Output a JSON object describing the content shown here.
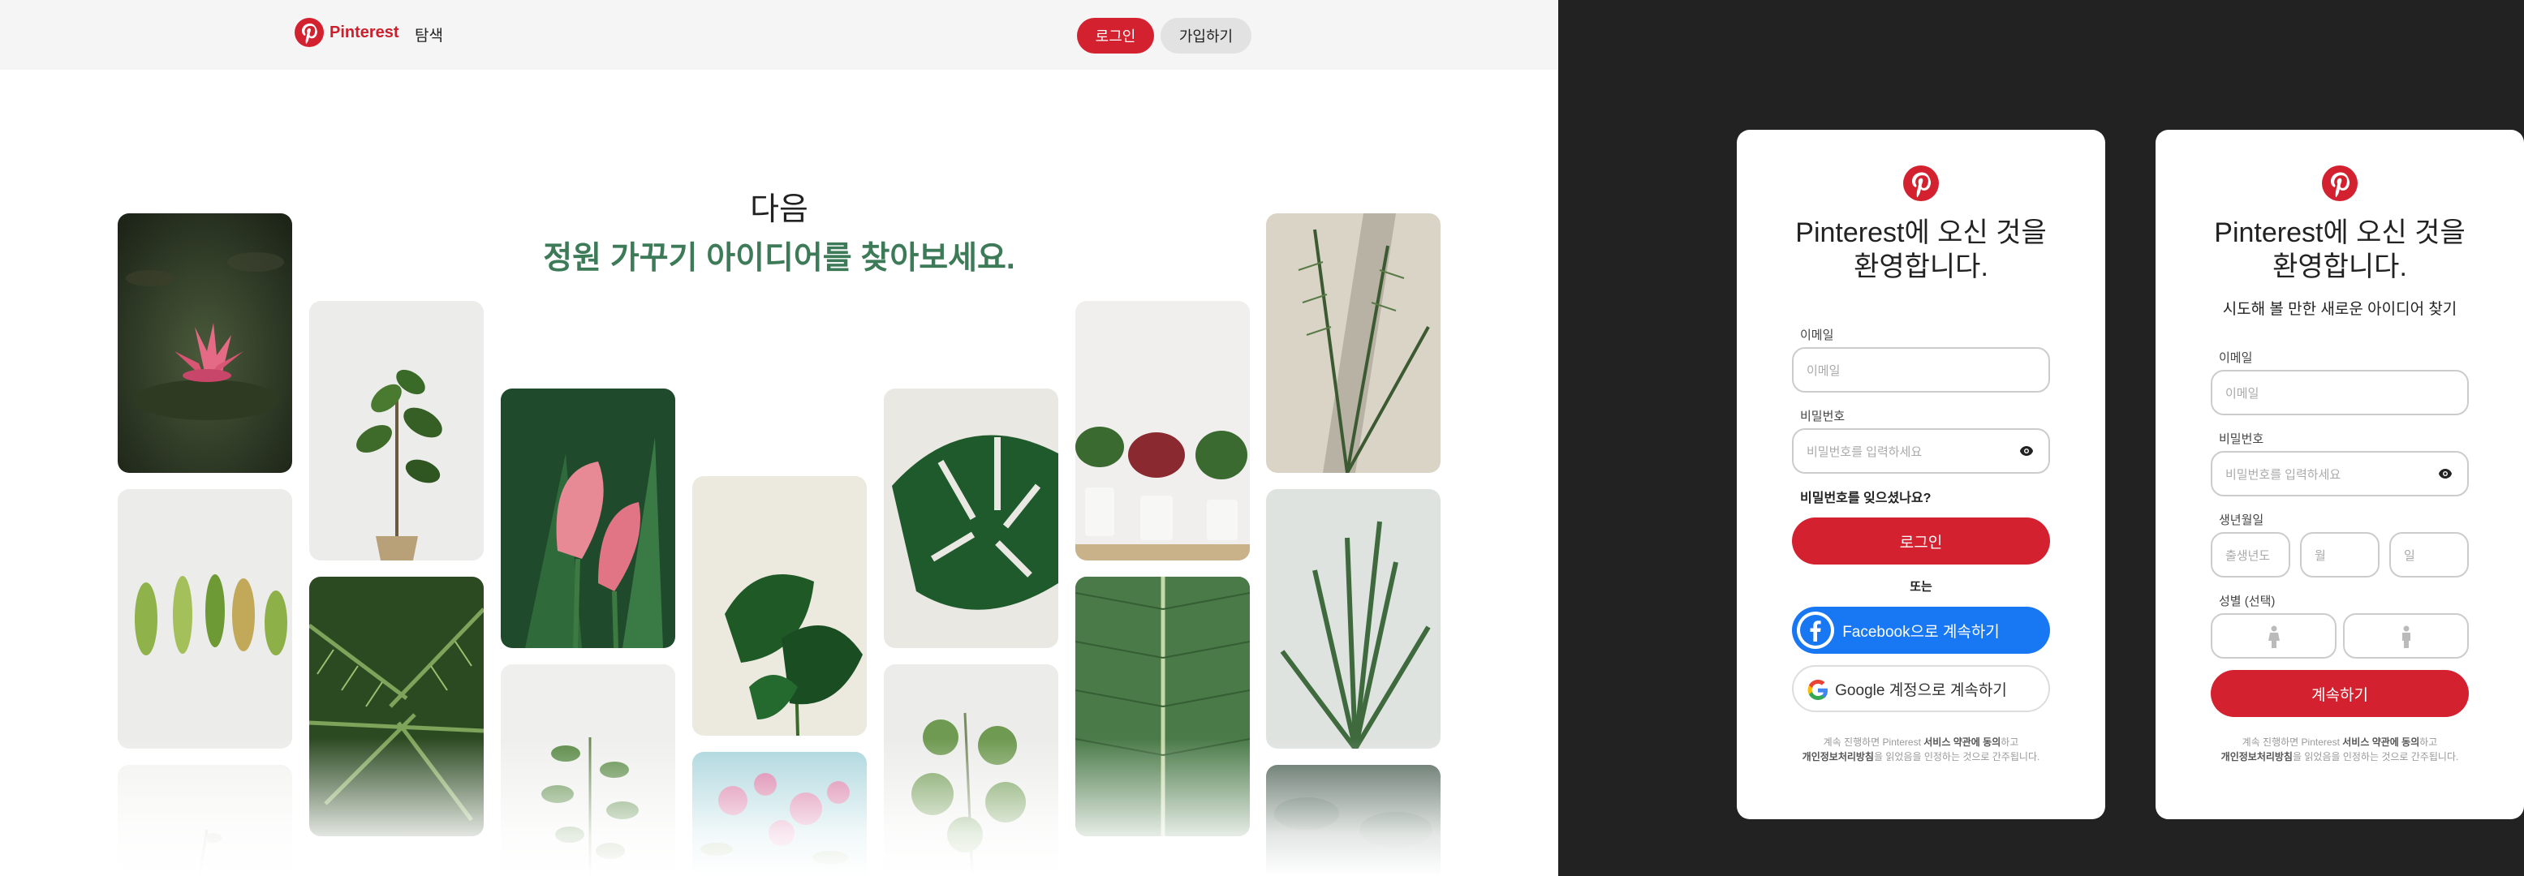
{
  "header": {
    "brand": "Pinterest",
    "nav_explore": "탐색",
    "login_label": "로그인",
    "signup_label": "가입하기"
  },
  "hero": {
    "line1": "다음",
    "line2": "정원 가꾸기 아이디어를 찾아보세요."
  },
  "grid": {
    "tiles": [
      "water-lily",
      "fern-leaves",
      "faded-twig",
      "fiddle-leaf-fig",
      "palm-fronds",
      "calla-lily",
      "leafy-vine",
      "monstera-plant",
      "pink-flowers",
      "monstera-leaf",
      "eucalyptus",
      "potted-plants",
      "banana-leaf",
      "palm-shadow",
      "dracaena",
      "dark-foliage"
    ]
  },
  "login_card": {
    "title_line1": "Pinterest에 오신 것을",
    "title_line2": "환영합니다.",
    "email_label": "이메일",
    "email_placeholder": "이메일",
    "password_label": "비밀번호",
    "password_placeholder": "비밀번호를 입력하세요",
    "forgot_password": "비밀번호를 잊으셨나요?",
    "login_button": "로그인",
    "or_text": "또는",
    "facebook_button": "Facebook으로 계속하기",
    "google_button": "Google 계정으로 계속하기",
    "terms": {
      "prefix": "계속 진행하면 Pinterest ",
      "terms_link": "서비스 약관에 동의",
      "middle": "하고",
      "privacy_link": "개인정보처리방침",
      "suffix": "을 읽었음을 인정하는 것으로 간주됩니다."
    }
  },
  "signup_card": {
    "title_line1": "Pinterest에 오신 것을",
    "title_line2": "환영합니다.",
    "subtitle": "시도해 볼 만한 새로운 아이디어 찾기",
    "email_label": "이메일",
    "email_placeholder": "이메일",
    "password_label": "비밀번호",
    "password_placeholder": "비밀번호를 입력하세요",
    "birthdate_label": "생년월일",
    "birth_year_placeholder": "출생년도",
    "birth_month_placeholder": "월",
    "birth_day_placeholder": "일",
    "gender_label": "성별 (선택)",
    "continue_button": "계속하기",
    "terms": {
      "prefix": "계속 진행하면 Pinterest ",
      "terms_link": "서비스 약관에 동의",
      "middle": "하고",
      "privacy_link": "개인정보처리방침",
      "suffix": "을 읽었음을 인정하는 것으로 간주됩니다."
    }
  },
  "colors": {
    "brand_red": "#d3212f",
    "hero_green": "#3c7a58",
    "facebook_blue": "#1877f2",
    "backdrop": "#222222"
  }
}
